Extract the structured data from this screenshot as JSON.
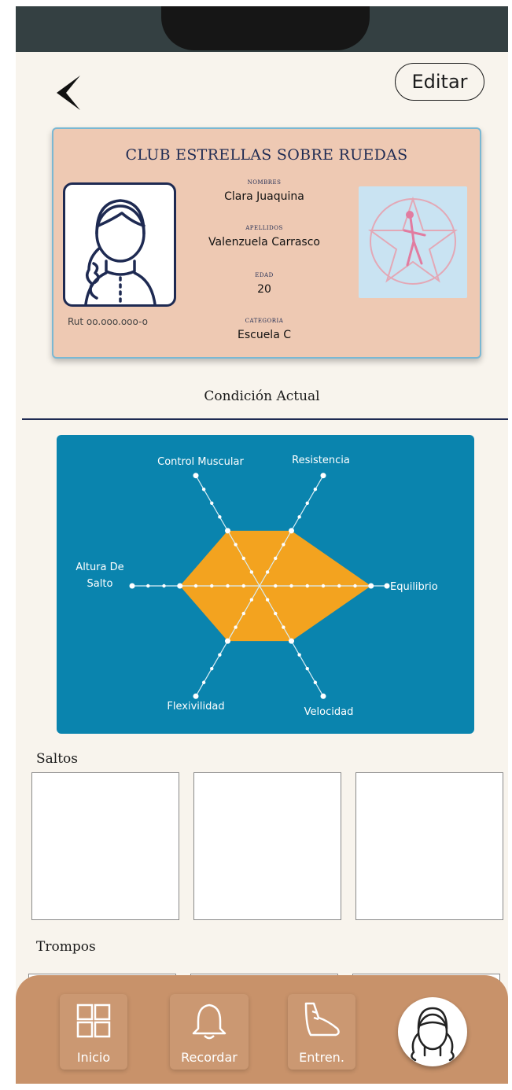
{
  "header": {
    "edit_label": "Editar"
  },
  "card": {
    "club_name": "CLUB ESTRELLAS SOBRE RUEDAS",
    "rut": "Rut oo.ooo.ooo-o",
    "fields": [
      {
        "label": "NOMBRES",
        "value": "Clara Juaquina"
      },
      {
        "label": "APELLIDOS",
        "value": "Valenzuela Carrasco"
      },
      {
        "label": "EDAD",
        "value": "20"
      },
      {
        "label": "CATEGORIA",
        "value": "Escuela C"
      }
    ]
  },
  "condition": {
    "title": "Condición Actual"
  },
  "chart_data": {
    "type": "radar",
    "axes": [
      "Resistencia",
      "Equilibrio",
      "Velocidad",
      "Flexivilidad",
      "Altura De Salto",
      "Control Muscular"
    ],
    "rings": 7,
    "values": [
      4,
      7,
      4,
      4,
      5,
      4
    ],
    "max": 8,
    "fill_color": "#f3a31f",
    "background": "#0a84ae"
  },
  "sections": [
    {
      "title": "Saltos",
      "items": 3
    },
    {
      "title": "Trompos",
      "items": 3
    }
  ],
  "nav": {
    "items": [
      {
        "label": "Inicio",
        "icon": "grid-icon"
      },
      {
        "label": "Recordar",
        "icon": "bell-icon"
      },
      {
        "label": "Entren.",
        "icon": "skate-icon"
      }
    ],
    "profile_icon": "avatar-icon"
  },
  "colors": {
    "accent": "#f3a31f",
    "panel": "#0a84ae",
    "card": "#eec9b3",
    "nav": "#c8926a"
  }
}
